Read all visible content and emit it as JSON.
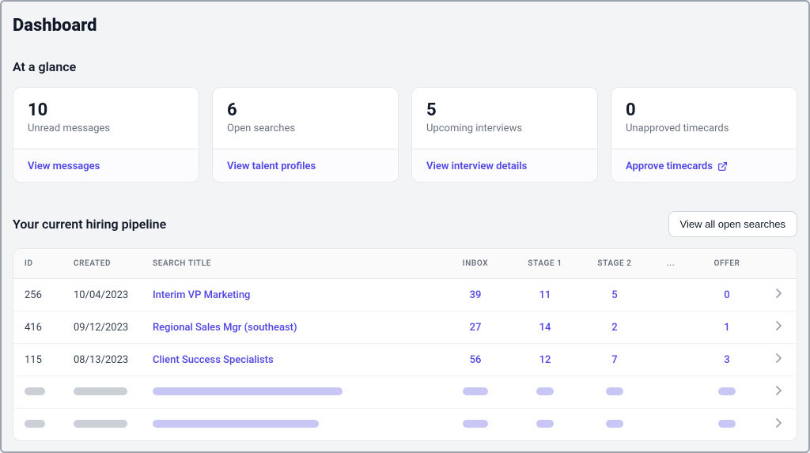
{
  "page_title": "Dashboard",
  "glance": {
    "heading": "At a glance",
    "cards": [
      {
        "value": "10",
        "label": "Unread messages",
        "link": "View messages",
        "external": false
      },
      {
        "value": "6",
        "label": "Open searches",
        "link": "View talent profiles",
        "external": false
      },
      {
        "value": "5",
        "label": "Upcoming interviews",
        "link": "View interview details",
        "external": false
      },
      {
        "value": "0",
        "label": "Unapproved timecards",
        "link": "Approve timecards",
        "external": true
      }
    ]
  },
  "pipeline": {
    "heading": "Your current hiring pipeline",
    "view_all_label": "View all open searches",
    "columns": {
      "id": "ID",
      "created": "CREATED",
      "title": "SEARCH TITLE",
      "inbox": "INBOX",
      "stage1": "STAGE 1",
      "stage2": "STAGE 2",
      "dots": "...",
      "offer": "OFFER"
    },
    "rows": [
      {
        "id": "256",
        "created": "10/04/2023",
        "title": "Interim VP Marketing",
        "inbox": "39",
        "stage1": "11",
        "stage2": "5",
        "offer": "0"
      },
      {
        "id": "416",
        "created": "09/12/2023",
        "title": "Regional Sales Mgr (southeast)",
        "inbox": "27",
        "stage1": "14",
        "stage2": "2",
        "offer": "1"
      },
      {
        "id": "115",
        "created": "08/13/2023",
        "title": "Client Success Specialists",
        "inbox": "56",
        "stage1": "12",
        "stage2": "7",
        "offer": "3"
      }
    ]
  },
  "colors": {
    "accent": "#4f46e5"
  }
}
